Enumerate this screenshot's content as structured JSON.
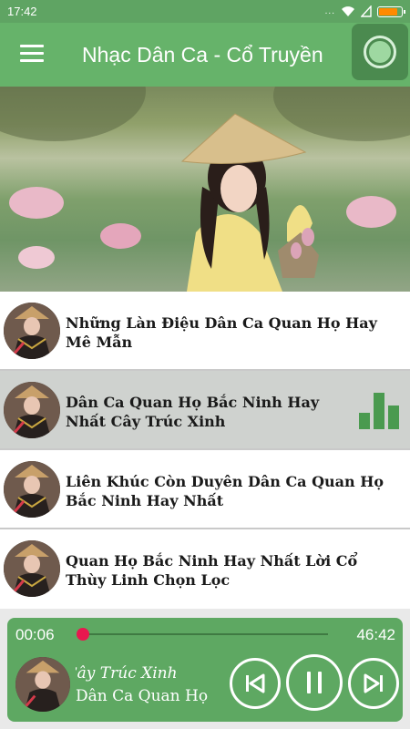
{
  "status_bar": {
    "time": "17:42",
    "dots": "..."
  },
  "app_bar": {
    "title": "Nhạc Dân Ca - Cổ Truyền"
  },
  "songs": [
    {
      "title": "Những Làn Điệu Dân Ca Quan Họ Hay Mê Mẫn",
      "active": false
    },
    {
      "title": "Dân Ca Quan Họ Bắc Ninh Hay Nhất Cây Trúc Xinh",
      "active": true
    },
    {
      "title": "Liên Khúc Còn Duyên Dân Ca Quan Họ Bắc Ninh Hay Nhất",
      "active": false
    },
    {
      "title": "Quan Họ Bắc Ninh Hay Nhất Lời Cổ Thùy Linh Chọn Lọc",
      "active": false
    }
  ],
  "player": {
    "current_time": "00:06",
    "total_time": "46:42",
    "progress_fraction": 0.002,
    "song_title_visible": "ất Cây Trúc Xinh",
    "artist": "Dân Ca Quan Họ"
  },
  "colors": {
    "status_bar": "#5fa463",
    "app_bar": "#66b36a",
    "player": "#5ea862",
    "seek_thumb": "#e8174f",
    "equalizer": "#4a9a4f",
    "active_row": "#cfd2cf"
  },
  "icons": [
    "menu-icon",
    "wifi-icon",
    "signal-icon",
    "battery-icon",
    "float-bubble-icon",
    "equalizer-icon",
    "previous-icon",
    "pause-icon",
    "next-icon"
  ]
}
